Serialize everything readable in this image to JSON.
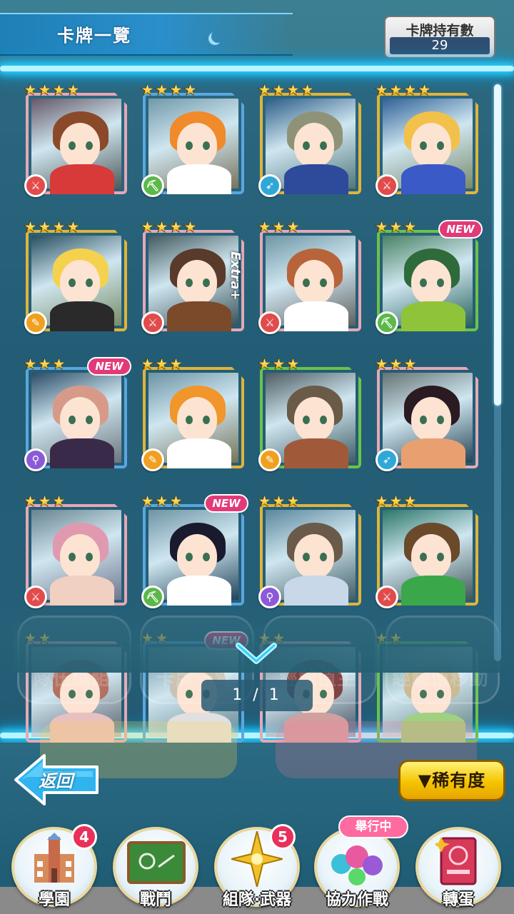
{
  "header": {
    "title": "卡牌一覽",
    "count_label": "卡牌持有數",
    "count_value": "29"
  },
  "colors": {
    "frame_pink": "#e5a8b6",
    "frame_gold": "#e0b43c",
    "frame_blue": "#5aa7e0",
    "frame_green": "#6cc24a",
    "type_red": "#e24b4b",
    "type_green": "#5cb84a",
    "type_blue": "#2fa8d8",
    "type_orange": "#f0a020",
    "type_purple": "#8c5ad8",
    "neon": "#2ed0ff",
    "new_badge": "#e23a78"
  },
  "cards": [
    {
      "stars": 4,
      "type_icon": "sword-icon",
      "type_color": "type_red",
      "frame": "frame_pink",
      "hair": "#8a4a2a",
      "outfit": "#d83a3a",
      "new": false,
      "extra": false
    },
    {
      "stars": 4,
      "type_icon": "axe-icon",
      "type_color": "type_green",
      "frame": "frame_blue",
      "hair": "#f08a2a",
      "outfit": "#ffffff",
      "new": false,
      "extra": false
    },
    {
      "stars": 4,
      "type_icon": "spear-icon",
      "type_color": "type_blue",
      "frame": "frame_gold",
      "hair": "#8e9378",
      "outfit": "#2e4a9a",
      "new": false,
      "extra": false
    },
    {
      "stars": 4,
      "type_icon": "sword-icon",
      "type_color": "type_red",
      "frame": "frame_gold",
      "hair": "#f2c14a",
      "outfit": "#3a5ac8",
      "new": false,
      "extra": false
    },
    {
      "stars": 4,
      "type_icon": "staff-icon",
      "type_color": "type_orange",
      "frame": "frame_gold",
      "hair": "#f4d24e",
      "outfit": "#2a2a2a",
      "new": false,
      "extra": false
    },
    {
      "stars": 4,
      "type_icon": "sword-icon",
      "type_color": "type_red",
      "frame": "frame_pink",
      "hair": "#5a3a2a",
      "outfit": "#7a4a2a",
      "new": false,
      "extra": true
    },
    {
      "stars": 3,
      "type_icon": "sword-icon",
      "type_color": "type_red",
      "frame": "frame_pink",
      "hair": "#b8643a",
      "outfit": "#ffffff",
      "new": false,
      "extra": false
    },
    {
      "stars": 3,
      "type_icon": "axe-icon",
      "type_color": "type_green",
      "frame": "frame_green",
      "hair": "#2e6a3a",
      "outfit": "#8fc43a",
      "new": true,
      "extra": false
    },
    {
      "stars": 3,
      "type_icon": "wand-icon",
      "type_color": "type_purple",
      "frame": "frame_blue",
      "hair": "#d89a88",
      "outfit": "#3a2a4a",
      "new": true,
      "extra": false
    },
    {
      "stars": 3,
      "type_icon": "staff-icon",
      "type_color": "type_orange",
      "frame": "frame_gold",
      "hair": "#f0962a",
      "outfit": "#ffffff",
      "new": false,
      "extra": false
    },
    {
      "stars": 3,
      "type_icon": "staff-icon",
      "type_color": "type_orange",
      "frame": "frame_green",
      "hair": "#6a5a48",
      "outfit": "#a05a3a",
      "new": false,
      "extra": false
    },
    {
      "stars": 3,
      "type_icon": "spear-icon",
      "type_color": "type_blue",
      "frame": "frame_pink",
      "hair": "#2a1a22",
      "outfit": "#e8a070",
      "new": false,
      "extra": false
    },
    {
      "stars": 3,
      "type_icon": "sword-icon",
      "type_color": "type_red",
      "frame": "frame_pink",
      "hair": "#e09ab0",
      "outfit": "#f0d0c0",
      "new": false,
      "extra": false
    },
    {
      "stars": 3,
      "type_icon": "axe-icon",
      "type_color": "type_green",
      "frame": "frame_blue",
      "hair": "#1a1a2e",
      "outfit": "#ffffff",
      "new": true,
      "extra": false
    },
    {
      "stars": 3,
      "type_icon": "wand-icon",
      "type_color": "type_purple",
      "frame": "frame_gold",
      "hair": "#6a5a4a",
      "outfit": "#c8d8e8",
      "new": false,
      "extra": false
    },
    {
      "stars": 3,
      "type_icon": "sword-icon",
      "type_color": "type_red",
      "frame": "frame_gold",
      "hair": "#6a4a2a",
      "outfit": "#3aa84a",
      "new": false,
      "extra": false
    },
    {
      "stars": 2,
      "type_icon": "",
      "type_color": "type_red",
      "frame": "frame_pink",
      "hair": "#b06a5a",
      "outfit": "#e8c0c0",
      "new": false,
      "extra": false
    },
    {
      "stars": 2,
      "type_icon": "",
      "type_color": "type_blue",
      "frame": "frame_blue",
      "hair": "#c8c0b0",
      "outfit": "#e0e0e0",
      "new": true,
      "extra": false
    },
    {
      "stars": 2,
      "type_icon": "",
      "type_color": "type_red",
      "frame": "frame_pink",
      "hair": "#7a3a3a",
      "outfit": "#d0a0a0",
      "new": false,
      "extra": false
    },
    {
      "stars": 2,
      "type_icon": "",
      "type_color": "type_green",
      "frame": "frame_green",
      "hair": "#c8b890",
      "outfit": "#a0d080",
      "new": false,
      "extra": false
    }
  ],
  "labels": {
    "new": "NEW",
    "extra": "Extra+"
  },
  "ghost_buttons": [
    "隊伍編組",
    "卡牌一覽",
    "經驗值主",
    "經驗值移動"
  ],
  "pager": "1 / 1",
  "back_label": "返回",
  "rarity_label": "▼稀有度",
  "nav": [
    {
      "label": "學園",
      "badge": "4",
      "icon": "school-icon"
    },
    {
      "label": "戰鬥",
      "badge": "",
      "icon": "chalkboard-icon"
    },
    {
      "label": "組隊·武器",
      "badge": "5",
      "icon": "compass-star-icon"
    },
    {
      "label": "協力作戰",
      "badge": "",
      "icon": "balloons-icon",
      "tag": "舉行中"
    },
    {
      "label": "轉蛋",
      "badge": "",
      "icon": "card-book-icon"
    }
  ]
}
